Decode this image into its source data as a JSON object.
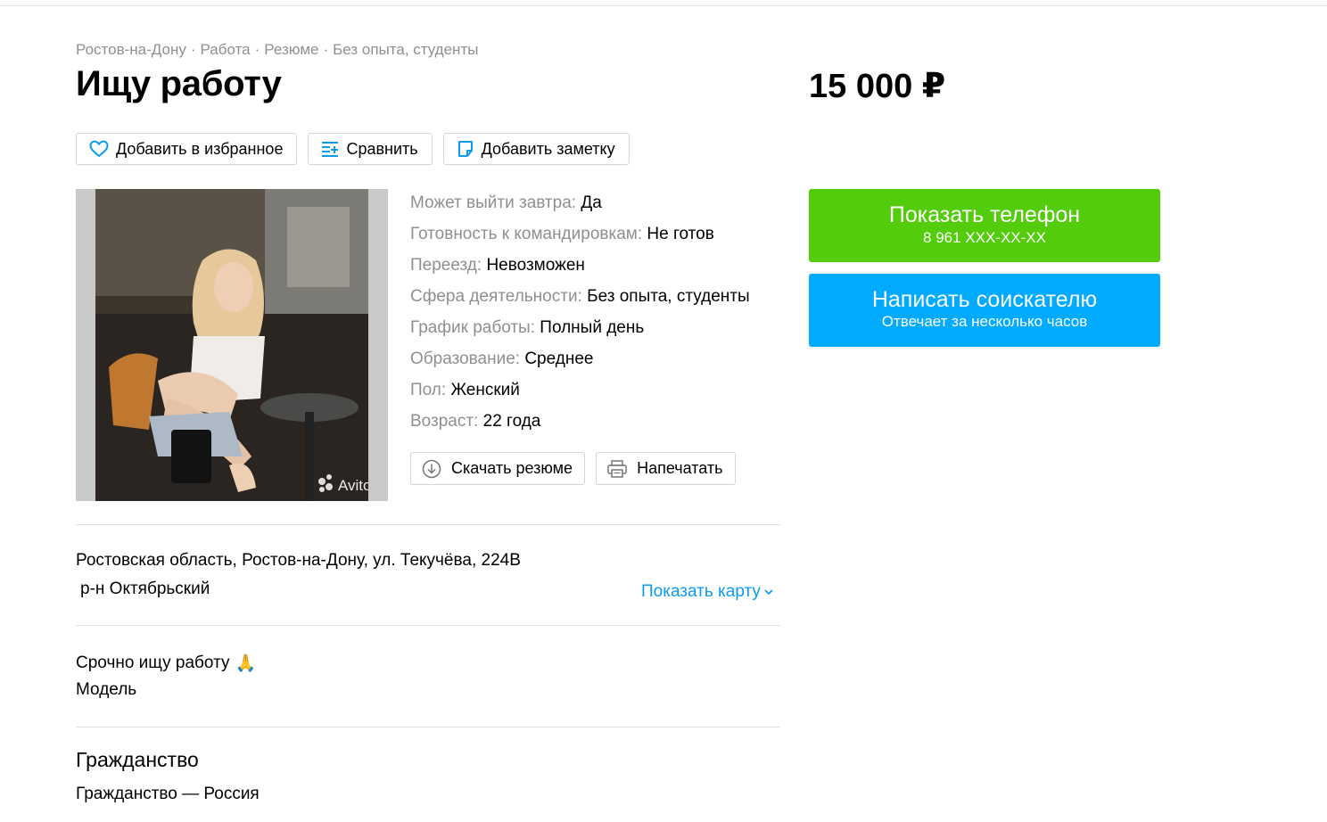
{
  "breadcrumbs": [
    "Ростов-на-Дону",
    "Работа",
    "Резюме",
    "Без опыта, студенты"
  ],
  "title": "Ищу работу",
  "price": "15 000 ₽",
  "toolbar": {
    "favorite": "Добавить в избранное",
    "compare": "Сравнить",
    "note": "Добавить заметку"
  },
  "photo": {
    "watermark": "Avito"
  },
  "params": [
    {
      "key": "Может выйти завтра:",
      "value": "Да"
    },
    {
      "key": "Готовность к командировкам:",
      "value": "Не готов"
    },
    {
      "key": "Переезд:",
      "value": "Невозможен"
    },
    {
      "key": "Сфера деятельности:",
      "value": "Без опыта, студенты"
    },
    {
      "key": "График работы:",
      "value": "Полный день"
    },
    {
      "key": "Образование:",
      "value": "Среднее"
    },
    {
      "key": "Пол:",
      "value": "Женский"
    },
    {
      "key": "Возраст:",
      "value": "22 года"
    }
  ],
  "actions": {
    "download": "Скачать резюме",
    "print": "Напечатать"
  },
  "location": {
    "address": "Ростовская область, Ростов-на-Дону, ул. Текучёва, 224В",
    "district": "р-н Октябрьский",
    "show_map": "Показать карту"
  },
  "description": {
    "line1": "Срочно ищу работу",
    "emoji": "🙏",
    "line2": "Модель"
  },
  "citizenship": {
    "title": "Гражданство",
    "text": "Гражданство — Россия"
  },
  "phone_button": {
    "label": "Показать телефон",
    "number": "8 961 XXX-XX-XX"
  },
  "message_button": {
    "label": "Написать соискателю",
    "sub": "Отвечает за несколько часов"
  },
  "colors": {
    "green": "#53cc0b",
    "blue": "#00aaff",
    "link": "#0a9bea",
    "muted": "#8f8f8f"
  }
}
